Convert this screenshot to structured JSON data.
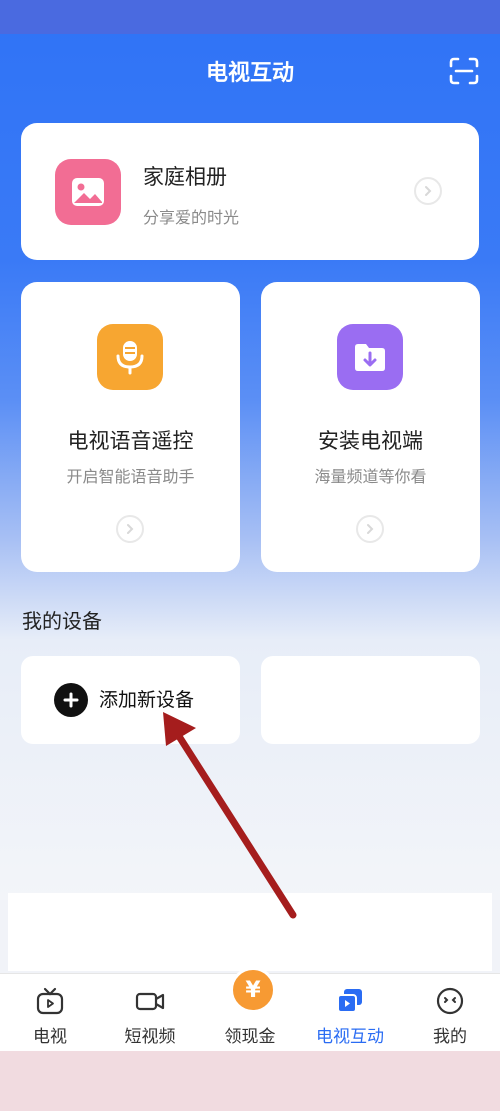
{
  "header": {
    "title": "电视互动"
  },
  "album": {
    "title": "家庭相册",
    "subtitle": "分享爱的时光"
  },
  "features": [
    {
      "title": "电视语音遥控",
      "subtitle": "开启智能语音助手"
    },
    {
      "title": "安装电视端",
      "subtitle": "海量频道等你看"
    }
  ],
  "devices": {
    "section_title": "我的设备",
    "add_label": "添加新设备"
  },
  "tabs": [
    {
      "label": "电视",
      "icon": "tv-icon"
    },
    {
      "label": "短视频",
      "icon": "video-camera-icon"
    },
    {
      "label": "领现金",
      "icon": "coin-icon",
      "coin_symbol": "¥"
    },
    {
      "label": "电视互动",
      "icon": "screen-cast-icon",
      "active": true
    },
    {
      "label": "我的",
      "icon": "smile-face-icon"
    }
  ],
  "colors": {
    "primary": "#2f73f6",
    "album_icon": "#f26d94",
    "voice_icon": "#f7a631",
    "install_icon": "#9a6df2",
    "coin": "#f79a33",
    "annotation_arrow": "#a51d1d"
  }
}
